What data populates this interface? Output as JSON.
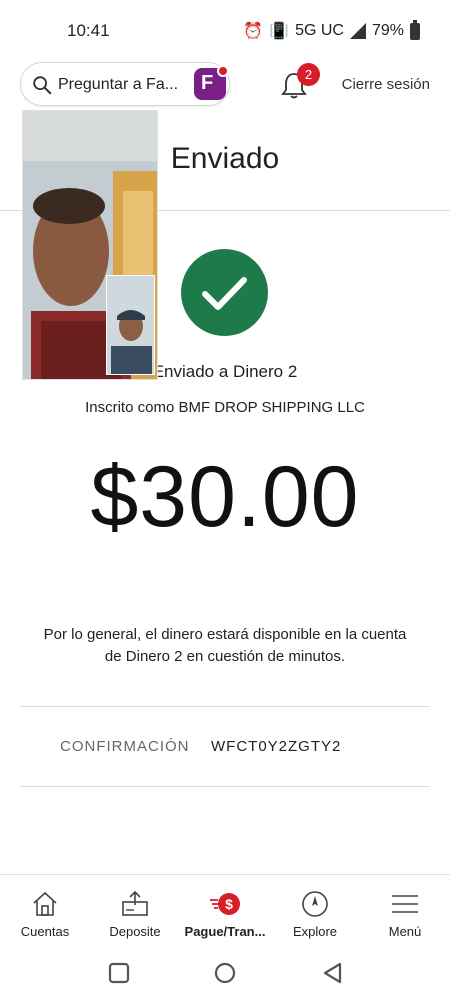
{
  "status_bar": {
    "time": "10:41",
    "network": "5G UC",
    "battery": "79%"
  },
  "header": {
    "search_placeholder": "Preguntar a Fa...",
    "notification_count": "2",
    "signout_label": "Cierre sesión"
  },
  "page": {
    "title": "Enviado",
    "sent_to": "Enviado a Dinero 2",
    "enrolled_as": "Inscrito como BMF DROP SHIPPING LLC",
    "amount": "$30.00",
    "availability_note": "Por lo general, el dinero estará disponible en la cuenta de Dinero 2 en cuestión de minutos.",
    "confirmation_label": "CONFIRMACIÓN",
    "confirmation_value": "WFCT0Y2ZGTY2"
  },
  "colors": {
    "success": "#1f7a4a",
    "brand_red": "#d71e28",
    "fargo_purple": "#7a1f86"
  },
  "bottom_nav": [
    {
      "label": "Cuentas",
      "icon": "house-icon"
    },
    {
      "label": "Deposite",
      "icon": "deposit-check-icon"
    },
    {
      "label": "Pague/Tran...",
      "icon": "pay-transfer-icon"
    },
    {
      "label": "Explore",
      "icon": "compass-icon"
    },
    {
      "label": "Menú",
      "icon": "hamburger-icon"
    }
  ]
}
